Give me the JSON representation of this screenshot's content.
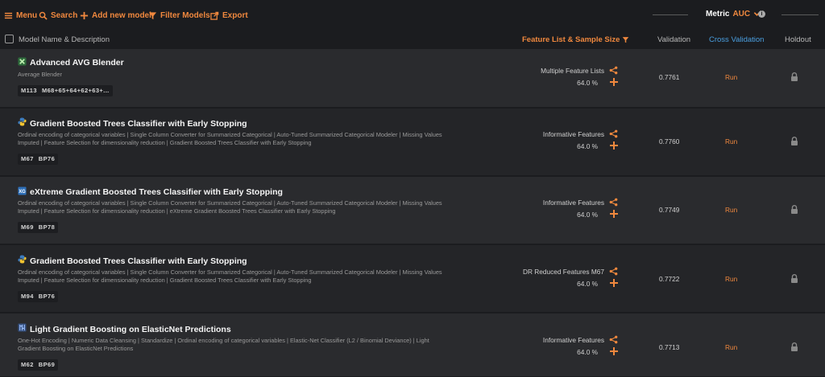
{
  "toolbar": {
    "menu": "Menu",
    "search": "Search",
    "add_model": "Add new model",
    "filter": "Filter Models",
    "export": "Export",
    "metric_label": "Metric",
    "metric_value": "AUC",
    "accent_color": "#f0883e"
  },
  "columns": {
    "model": "Model Name & Description",
    "feature": "Feature List & Sample Size",
    "validation": "Validation",
    "cross_validation": "Cross Validation",
    "holdout": "Holdout"
  },
  "rows": [
    {
      "icon": "blender-icon",
      "title": "Advanced AVG Blender",
      "desc": "Average Blender",
      "badges": [
        "M113",
        "M68+65+64+62+63+..."
      ],
      "feature_list": "Multiple Feature Lists",
      "sample": "64.0 %",
      "validation": "0.7761",
      "cv": "Run"
    },
    {
      "icon": "python-icon",
      "title": "Gradient Boosted Trees Classifier with Early Stopping",
      "desc": "Ordinal encoding of categorical variables | Single Column Converter for Summarized Categorical | Auto-Tuned Summarized Categorical Modeler | Missing Values Imputed | Feature Selection for dimensionality reduction | Gradient Boosted Trees Classifier with Early Stopping",
      "badges": [
        "M67",
        "BP76"
      ],
      "feature_list": "Informative Features",
      "sample": "64.0 %",
      "validation": "0.7760",
      "cv": "Run"
    },
    {
      "icon": "xgboost-icon",
      "title": "eXtreme Gradient Boosted Trees Classifier with Early Stopping",
      "desc": "Ordinal encoding of categorical variables | Single Column Converter for Summarized Categorical | Auto-Tuned Summarized Categorical Modeler | Missing Values Imputed | Feature Selection for dimensionality reduction | eXtreme Gradient Boosted Trees Classifier with Early Stopping",
      "badges": [
        "M69",
        "BP78"
      ],
      "feature_list": "Informative Features",
      "sample": "64.0 %",
      "validation": "0.7749",
      "cv": "Run"
    },
    {
      "icon": "python-icon",
      "title": "Gradient Boosted Trees Classifier with Early Stopping",
      "desc": "Ordinal encoding of categorical variables | Single Column Converter for Summarized Categorical | Auto-Tuned Summarized Categorical Modeler | Missing Values Imputed | Feature Selection for dimensionality reduction | Gradient Boosted Trees Classifier with Early Stopping",
      "badges": [
        "M94",
        "BP76"
      ],
      "feature_list": "DR Reduced Features M67",
      "sample": "64.0 %",
      "validation": "0.7722",
      "cv": "Run"
    },
    {
      "icon": "lightgbm-icon",
      "title": "Light Gradient Boosting on ElasticNet Predictions",
      "desc": "One-Hot Encoding | Numeric Data Cleansing | Standardize | Ordinal encoding of categorical variables | Elastic-Net Classifier (L2 / Binomial Deviance) | Light Gradient Boosting on ElasticNet Predictions",
      "badges": [
        "M62",
        "BP69"
      ],
      "feature_list": "Informative Features",
      "sample": "64.0 %",
      "validation": "0.7713",
      "cv": "Run"
    }
  ]
}
